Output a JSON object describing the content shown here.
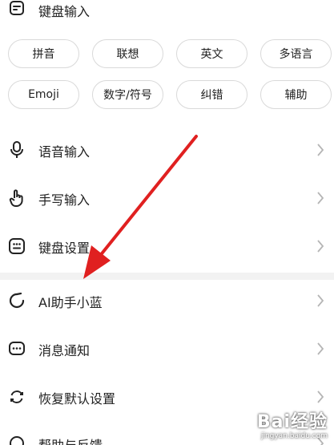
{
  "header_item": {
    "label": "键盘输入"
  },
  "chips_row1": [
    "拼音",
    "联想",
    "英文",
    "多语言"
  ],
  "chips_row2": [
    "Emoji",
    "数字/符号",
    "纠错",
    "辅助"
  ],
  "section1": [
    {
      "label": "语音输入",
      "icon": "microphone-icon"
    },
    {
      "label": "手写输入",
      "icon": "hand-pointer-icon"
    },
    {
      "label": "键盘设置",
      "icon": "keyboard-icon"
    }
  ],
  "section2": [
    {
      "label": "AI助手小蓝",
      "icon": "ai-assistant-icon"
    },
    {
      "label": "消息通知",
      "icon": "message-icon"
    },
    {
      "label": "恢复默认设置",
      "icon": "restore-icon"
    },
    {
      "label": "帮助与反馈",
      "icon": "help-icon"
    }
  ],
  "watermark": {
    "brand": "Bai经验",
    "url": "jingyan.baidu.com"
  },
  "colors": {
    "arrow": "#e02020",
    "divider": "#f2f2f2",
    "chip_border": "#d9d9d9",
    "chevron": "#b5b5b5"
  }
}
